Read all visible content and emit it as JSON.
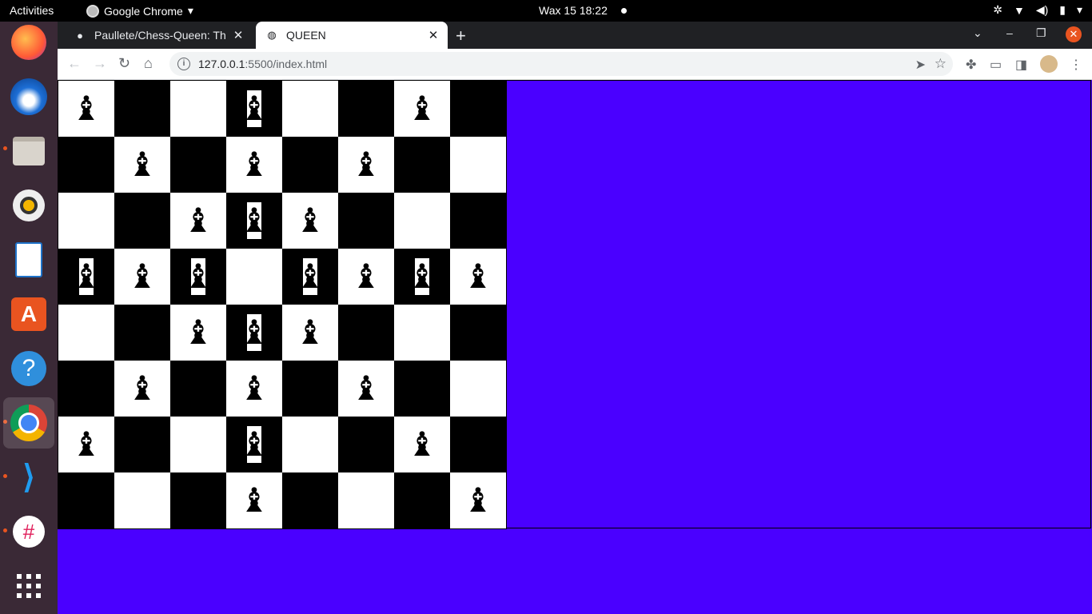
{
  "topbar": {
    "activities": "Activities",
    "app_name": "Google Chrome",
    "clock": "Wax 15  18:22"
  },
  "dock": {
    "items": [
      "firefox-icon",
      "thunderbird-icon",
      "files-icon",
      "rhythmbox-icon",
      "libreoffice-writer-icon",
      "ubuntu-software-icon",
      "help-icon",
      "chrome-icon",
      "vscode-icon",
      "slack-icon",
      "app-grid-icon"
    ]
  },
  "tabs": [
    {
      "title": "Paullete/Chess-Queen: Th",
      "icon": "github-icon",
      "active": false
    },
    {
      "title": "QUEEN",
      "icon": "globe-icon",
      "active": true
    }
  ],
  "toolbar": {
    "url_host": "127.0.0.1",
    "url_path": ":5500/index.html"
  },
  "page": {
    "background_color": "#4a00ff",
    "piece_glyph": "♝",
    "board": [
      [
        1,
        0,
        0,
        1,
        0,
        0,
        1,
        0
      ],
      [
        0,
        1,
        0,
        1,
        0,
        1,
        0,
        0
      ],
      [
        0,
        0,
        1,
        1,
        1,
        0,
        0,
        0
      ],
      [
        1,
        1,
        1,
        0,
        1,
        1,
        1,
        1
      ],
      [
        0,
        0,
        1,
        1,
        1,
        0,
        0,
        0
      ],
      [
        0,
        1,
        0,
        1,
        0,
        1,
        0,
        0
      ],
      [
        1,
        0,
        0,
        1,
        0,
        0,
        1,
        0
      ],
      [
        0,
        0,
        0,
        1,
        0,
        0,
        0,
        1
      ]
    ]
  }
}
